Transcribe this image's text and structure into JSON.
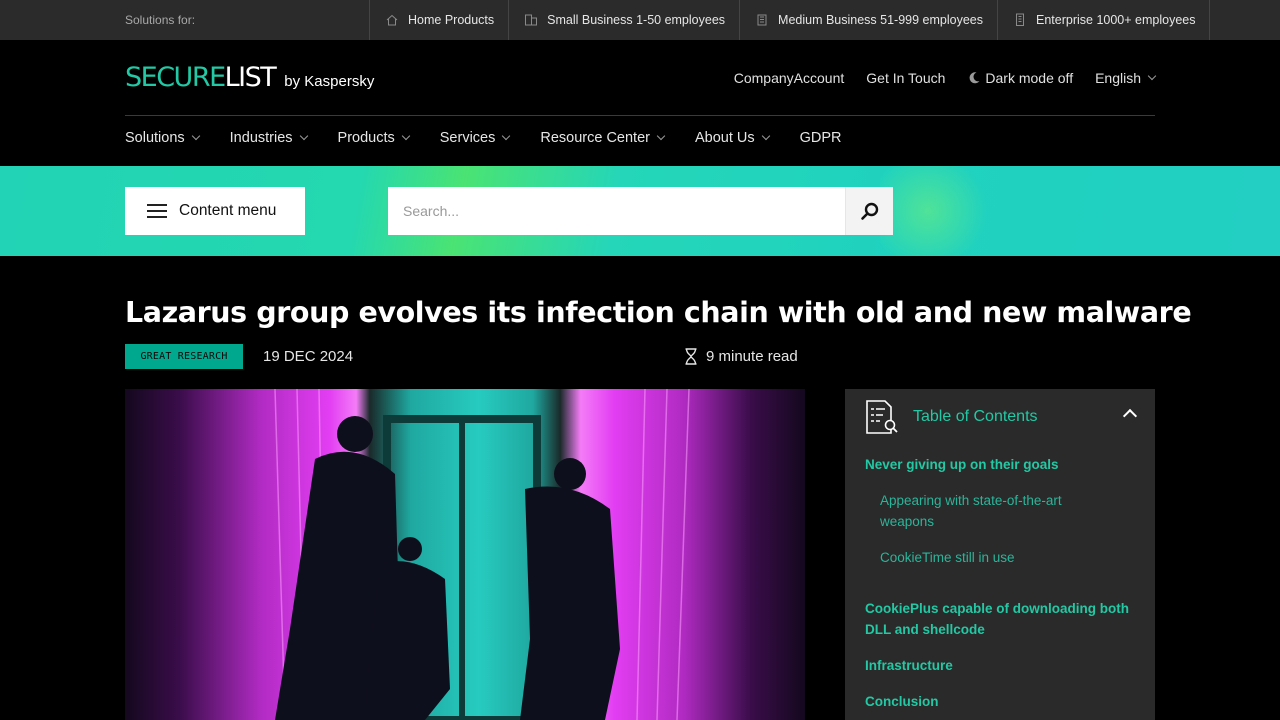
{
  "topbar": {
    "label": "Solutions for:",
    "segments": [
      {
        "label": "Home Products",
        "icon": "home-icon"
      },
      {
        "label": "Small Business 1-50 employees",
        "icon": "building-small-icon"
      },
      {
        "label": "Medium Business 51-999 employees",
        "icon": "building-medium-icon"
      },
      {
        "label": "Enterprise 1000+ employees",
        "icon": "building-large-icon"
      }
    ]
  },
  "header": {
    "logo_part1": "SECURE",
    "logo_part2": "LIST",
    "logo_by": "by Kaspersky",
    "links": {
      "company_account": "CompanyAccount",
      "get_in_touch": "Get In Touch",
      "dark_mode": "Dark mode off",
      "language": "English"
    }
  },
  "nav": {
    "items": [
      "Solutions",
      "Industries",
      "Products",
      "Services",
      "Resource Center",
      "About Us",
      "GDPR"
    ]
  },
  "band": {
    "content_menu": "Content menu",
    "search_placeholder": "Search..."
  },
  "article": {
    "title": "Lazarus group evolves its infection chain with old and new malware",
    "tag": "GREAT RESEARCH",
    "date": "19 DEC 2024",
    "read_time": "9 minute read"
  },
  "toc": {
    "title": "Table of Contents",
    "items": [
      {
        "label": "Never giving up on their goals"
      },
      {
        "label": "Appearing with state-of-the-art weapons"
      },
      {
        "label": "CookieTime still in use"
      },
      {
        "label": "CookiePlus capable of downloading both DLL and shellcode"
      },
      {
        "label": "Infrastructure"
      },
      {
        "label": "Conclusion"
      }
    ]
  },
  "colors": {
    "accent": "#22c9a4",
    "tag_bg": "#00a88e",
    "topbar_bg": "#2b2b2b",
    "toc_bg": "#2a2a2a"
  }
}
